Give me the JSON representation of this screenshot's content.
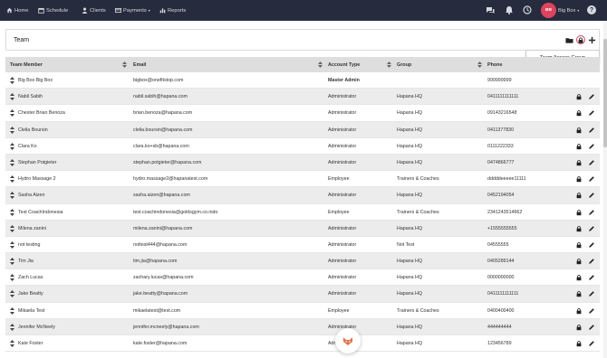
{
  "nav": {
    "items": [
      {
        "label": "Home",
        "icon": "home-icon"
      },
      {
        "label": "Schedule",
        "icon": "calendar-icon"
      },
      {
        "label": "Clients",
        "icon": "user-icon"
      },
      {
        "label": "Payments",
        "icon": "payments-icon"
      },
      {
        "label": "Reports",
        "icon": "chart-icon"
      }
    ],
    "right_icons": [
      "chat-icon",
      "bell-icon",
      "clock-icon"
    ],
    "profile": {
      "initials": "BB",
      "name": "Big Box"
    },
    "help_glyph": "?"
  },
  "panel": {
    "title": "Team"
  },
  "tooltip": {
    "text": "Team Access Group"
  },
  "table": {
    "columns": [
      "Team Member",
      "Email",
      "Account Type",
      "Group",
      "Phone"
    ],
    "rows": [
      {
        "name": "Big Box Big Box",
        "email": "bigbox@onefitstop.com",
        "type": "Master Admin",
        "group": "",
        "phone": "999999999"
      },
      {
        "name": "Nabil Sabih",
        "email": "nabil.sabih@hapana.com",
        "type": "Administrator",
        "group": "Hapana HQ",
        "phone": "0411111111111"
      },
      {
        "name": "Chester Brian Benoza",
        "email": "brian.benoza@hapana.com",
        "type": "Administrator",
        "group": "Hapana HQ",
        "phone": "09143216548"
      },
      {
        "name": "Clelia Boursin",
        "email": "clelia.boursin@hapana.com",
        "type": "Administrator",
        "group": "Hapana HQ",
        "phone": "0411377830"
      },
      {
        "name": "Clara Ko",
        "email": "clara.ko+sb@hapana.com",
        "type": "Administrator",
        "group": "Hapana HQ",
        "phone": "0111222333"
      },
      {
        "name": "Stephan Potgieter",
        "email": "stephan.potgieter@hapana.com",
        "type": "Administrator",
        "group": "Hapana HQ",
        "phone": "0474866777"
      },
      {
        "name": "Hydro Massage 2",
        "email": "hydro.massage2@hapanatest.com",
        "type": "Employee",
        "group": "Trainers & Coaches",
        "phone": "dddddeeeee11111"
      },
      {
        "name": "Sasha Aizen",
        "email": "sasha.aizen@hapana.com",
        "type": "Administrator",
        "group": "Hapana HQ",
        "phone": "0452194054"
      },
      {
        "name": "Test CoachIndonesia",
        "email": "test.coachindonesia@goldsgym.co.indo",
        "type": "Employee",
        "group": "Trainers & Coaches",
        "phone": "2341243514662"
      },
      {
        "name": "Milena zanini",
        "email": "milena.zanini@hapana.com",
        "type": "Administrator",
        "group": "Hapana HQ",
        "phone": "+1555555555"
      },
      {
        "name": "not testing",
        "email": "nottest444@hapana.com",
        "type": "Administrator",
        "group": "Not Test",
        "phone": "04555555"
      },
      {
        "name": "Tim Jia",
        "email": "tim.jia@hapana.com",
        "type": "Administrator",
        "group": "Hapana HQ",
        "phone": "0405289144"
      },
      {
        "name": "Zach Lucas",
        "email": "zachary.lucas@hapana.com",
        "type": "Administrator",
        "group": "Hapana HQ",
        "phone": "0000000000"
      },
      {
        "name": "Jake Beatty",
        "email": "jake.beatty@hapana.com",
        "type": "Administrator",
        "group": "Hapana HQ",
        "phone": "0411111111111"
      },
      {
        "name": "Mikaela Test",
        "email": "mikaelatest@test.com",
        "type": "Employee",
        "group": "Trainers & Coaches",
        "phone": "0400400400"
      },
      {
        "name": "Jennifer McNeely",
        "email": "jennifer.mcneely@hapana.com",
        "type": "Administrator",
        "group": "Hapana HQ",
        "phone": "444444444"
      },
      {
        "name": "Kate Foster",
        "email": "kate.foster@hapana.com",
        "type": "Administrator",
        "group": "Hapana HQ",
        "phone": "123456789"
      }
    ]
  },
  "colors": {
    "nav_bg": "#262c3d",
    "accent": "#e0435d",
    "header_bg": "#dedede",
    "row_alt": "#ececec"
  }
}
